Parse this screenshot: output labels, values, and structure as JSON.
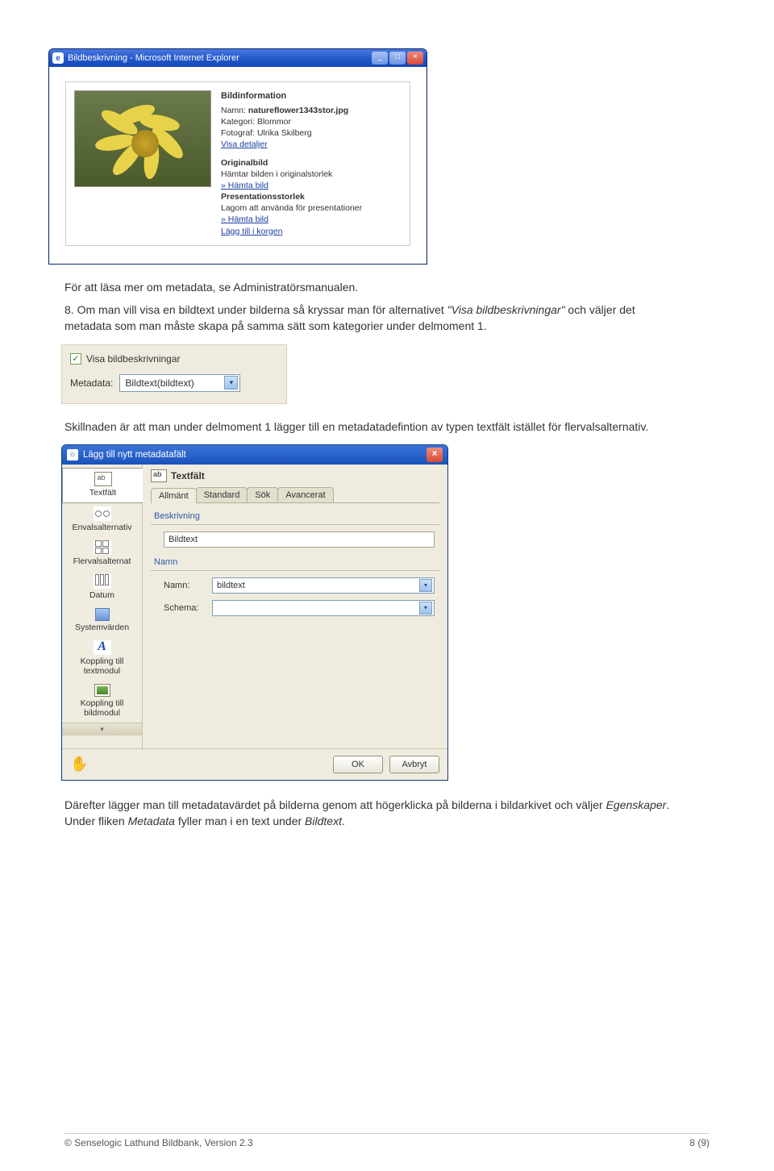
{
  "ie": {
    "title": "Bildbeskrivning - Microsoft Internet Explorer",
    "info_heading": "Bildinformation",
    "name_label": "Namn:",
    "name_value": "natureflower1343stor.jpg",
    "cat_label": "Kategori:",
    "cat_value": "Blommor",
    "photo_label": "Fotograf:",
    "photo_value": "Ulrika Skilberg",
    "details_link": "Visa detaljer",
    "orig_heading": "Originalbild",
    "orig_text": "Hämtar bilden i originalstorlek",
    "orig_link": "» Hämta bild",
    "pres_heading": "Presentationsstorlek",
    "pres_text": "Lagom att använda för presentationer",
    "pres_link": "» Hämta bild",
    "basket_link": "Lägg till i korgen"
  },
  "para1": "För att läsa mer om metadata, se Administratörsmanualen.",
  "para2_num": "8.",
  "para2_a": "Om man vill visa en bildtext under bilderna så kryssar man för alternativet ",
  "para2_em": "\"Visa bildbeskrivningar\"",
  "para2_b": " och väljer det metadata som man måste skapa på samma sätt som kategorier under delmoment 1.",
  "cbshot": {
    "cb_label": "Visa bildbeskrivningar",
    "md_label": "Metadata:",
    "md_value": "Bildtext(bildtext)"
  },
  "para3": "Skillnaden är att man under delmoment 1 lägger till en metadatadefintion av typen textfält istället för flervalsalternativ.",
  "dlg": {
    "title": "Lägg till nytt metadatafält",
    "side": [
      "Textfält",
      "Envalsalternativ",
      "Flervalsalternat",
      "Datum",
      "Systemvärden",
      "Koppling till textmodul",
      "Koppling till bildmodul"
    ],
    "main_head": "Textfält",
    "tabs": [
      "Allmänt",
      "Standard",
      "Sök",
      "Avancerat"
    ],
    "grp1": "Beskrivning",
    "grp1_value": "Bildtext",
    "grp2": "Namn",
    "name_label": "Namn:",
    "name_value": "bildtext",
    "schema_label": "Schema:",
    "schema_value": "",
    "ok": "OK",
    "cancel": "Avbryt"
  },
  "para4_a": "Därefter lägger man till metadatavärdet på bilderna genom att högerklicka på bilderna i bildarkivet och väljer ",
  "para4_em1": "Egenskaper",
  "para4_b": ". Under fliken ",
  "para4_em2": "Metadata",
  "para4_c": " fyller man i en text under ",
  "para4_em3": "Bildtext",
  "para4_d": ".",
  "footer_left": "© Senselogic Lathund Bildbank, Version 2.3",
  "footer_right": "8 (9)"
}
